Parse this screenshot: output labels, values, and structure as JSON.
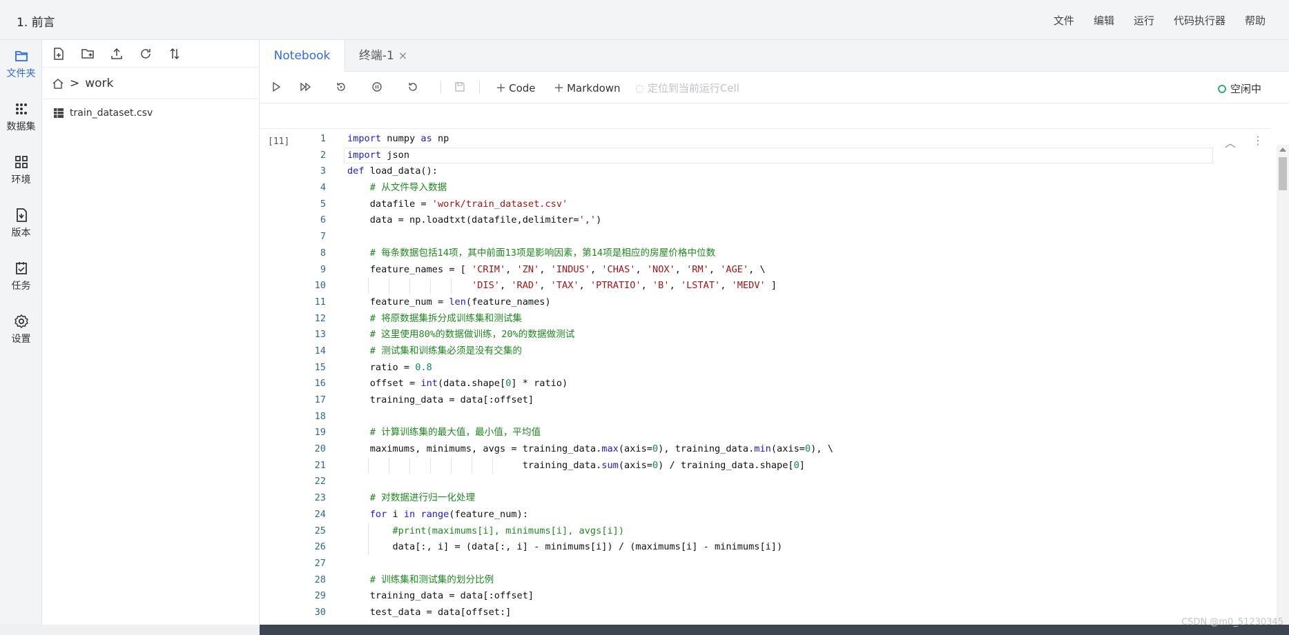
{
  "header": {
    "title": "1. 前言",
    "menu": [
      "文件",
      "编辑",
      "运行",
      "代码执行器",
      "帮助"
    ]
  },
  "rail": {
    "items": [
      {
        "label": "文件夹",
        "icon": "folder-icon",
        "active": true
      },
      {
        "label": "数据集",
        "icon": "dataset-icon",
        "active": false
      },
      {
        "label": "环境",
        "icon": "environment-icon",
        "active": false
      },
      {
        "label": "版本",
        "icon": "version-icon",
        "active": false
      },
      {
        "label": "任务",
        "icon": "task-icon",
        "active": false
      },
      {
        "label": "设置",
        "icon": "settings-icon",
        "active": false
      }
    ]
  },
  "files": {
    "toolbar_icons": [
      "new-file-icon",
      "new-folder-icon",
      "upload-icon",
      "refresh-icon",
      "sort-icon"
    ],
    "breadcrumb": {
      "home_icon": "home-icon",
      "separator": ">",
      "folder": "work"
    },
    "items": [
      {
        "name": "train_dataset.csv",
        "icon": "csv-file-icon"
      }
    ]
  },
  "tabs": [
    {
      "label": "Notebook",
      "active": true
    },
    {
      "label": "终端-1",
      "active": false,
      "close": "×"
    }
  ],
  "toolbar": {
    "icons": [
      "run-icon",
      "run-all-icon",
      "restart-run-icon",
      "interrupt-icon",
      "restart-icon",
      "save-icon"
    ],
    "add_code": "Code",
    "add_markdown": "Markdown",
    "locate_running": "定位到当前运行Cell",
    "kernel_status": "空闲中"
  },
  "cell": {
    "prompt": "[11]",
    "collapse_icon": "chevron-up-icon",
    "more_icon": "more-vertical-icon"
  },
  "code_lines": [
    "import numpy as np",
    "import json",
    "def load_data():",
    "    # 从文件导入数据",
    "    datafile = 'work/train_dataset.csv'",
    "    data = np.loadtxt(datafile,delimiter=',')",
    "",
    "    # 每条数据包括14项，其中前面13项是影响因素，第14项是相应的房屋价格中位数",
    "    feature_names = [ 'CRIM', 'ZN', 'INDUS', 'CHAS', 'NOX', 'RM', 'AGE', \\",
    "                      'DIS', 'RAD', 'TAX', 'PTRATIO', 'B', 'LSTAT', 'MEDV' ]",
    "    feature_num = len(feature_names)",
    "    # 将原数据集拆分成训练集和测试集",
    "    # 这里使用80%的数据做训练，20%的数据做测试",
    "    # 测试集和训练集必须是没有交集的",
    "    ratio = 0.8",
    "    offset = int(data.shape[0] * ratio)",
    "    training_data = data[:offset]",
    "",
    "    # 计算训练集的最大值，最小值，平均值",
    "    maximums, minimums, avgs = training_data.max(axis=0), training_data.min(axis=0), \\",
    "                               training_data.sum(axis=0) / training_data.shape[0]",
    "",
    "    # 对数据进行归一化处理",
    "    for i in range(feature_num):",
    "        #print(maximums[i], minimums[i], avgs[i])",
    "        data[:, i] = (data[:, i] - minimums[i]) / (maximums[i] - minimums[i])",
    "",
    "    # 训练集和测试集的划分比例",
    "    training_data = data[:offset]",
    "    test_data = data[offset:]"
  ],
  "watermark": "CSDN @m0_51230345",
  "colors": {
    "accent": "#2f6bdc",
    "keyword": "#1a1ae0",
    "string": "#a31515",
    "number": "#09885a",
    "comment": "#1e8a1e",
    "line_number": "#2d6a8e",
    "status_dot": "#26b26b"
  }
}
